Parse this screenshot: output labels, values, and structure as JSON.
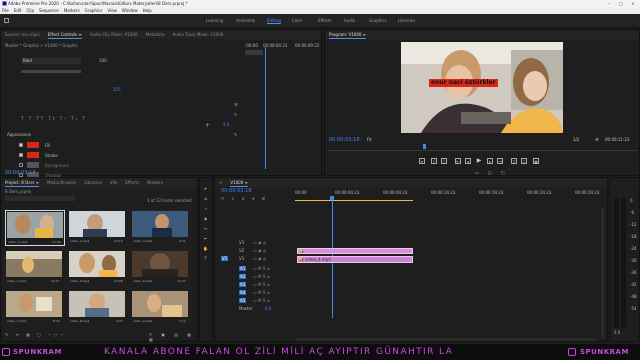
{
  "window": {
    "title": "Adobe Premiere Pro 2020 - C:\\Kullanıcılar\\Spoc\\Masaüstü\\Kurs Materyalleri\\8 Ders.prproj *",
    "controls": [
      "–",
      "□",
      "×"
    ]
  },
  "menu": [
    "File",
    "Edit",
    "Clip",
    "Sequence",
    "Markers",
    "Graphics",
    "View",
    "Window",
    "Help"
  ],
  "workspaces": {
    "items": [
      "Learning",
      "Assembly",
      "Editing",
      "Color",
      "Effects",
      "Audio",
      "Graphics",
      "Libraries"
    ],
    "active_index": 2
  },
  "source_panel": {
    "tabs": [
      "Source: (no clips)",
      "Effect Controls ≡",
      "Audio Clip Mixer: V1000",
      "Metadata",
      "Audio Track Mixer: V1000"
    ],
    "active_index": 1,
    "subheader": "Master * Graphic  >  V1000 * Graphic",
    "ruler_start": ":00:00",
    "ruler_mid": "00:00:04:23",
    "ruler_end": "00:00:09:22",
    "font_value": "Bold",
    "size_value": "100",
    "tracking_value": "125",
    "appearance_label": "Appearance",
    "fill_label": "Fill",
    "stroke_label": "Stroke",
    "stroke_value": "4.0",
    "background_label": "Background",
    "shadow_label": "Shadow",
    "mask_label": "Mask with Text",
    "transform_label": "Transform",
    "timecode": "00:00:03:18"
  },
  "program": {
    "tab": "Program: V1000 ≡",
    "overlay_text": "onur naci öztürkler",
    "timecode": "00:00:03:18",
    "fit": "Fit",
    "quality": "1/2",
    "duration": "00:00:11:23"
  },
  "project": {
    "tabs": [
      "Project: 8 Ders ≡",
      "Media Browser",
      "Libraries",
      "Info",
      "Effects",
      "Markers"
    ],
    "active_index": 0,
    "folder": "8 Ders.prproj",
    "item_count": "1 of 12 items selected",
    "clips": [
      {
        "name": "video_1.mp4",
        "dur": "12:00"
      },
      {
        "name": "video_2.mp4",
        "dur": "14:19"
      },
      {
        "name": "video_3.mp4",
        "dur": "9:21"
      },
      {
        "name": "video_4.mp4",
        "dur": "12:11"
      },
      {
        "name": "video_5.mp4",
        "dur": "23:08"
      },
      {
        "name": "video_6.mp4",
        "dur": "12:07"
      },
      {
        "name": "video_7.mp4",
        "dur": "8:22"
      },
      {
        "name": "video_8.mp4",
        "dur": "6:23"
      },
      {
        "name": "video_9.mp4",
        "dur": "7:12"
      }
    ]
  },
  "timeline": {
    "tab": "V1000 ≡",
    "timecode": "00:00:03:18",
    "ruler": [
      "00:00",
      "00:00:04:23",
      "00:00:09:23",
      "00:00:14:23",
      "00:00:19:23",
      "00:00:24:23",
      "00:00:29:23"
    ],
    "video_tracks": [
      "V3",
      "V2",
      "V1"
    ],
    "audio_tracks": [
      "A1",
      "A2",
      "A3",
      "A4",
      "A5"
    ],
    "master": "Master",
    "master_val": "0.0",
    "clip_graphic": "fx",
    "clip_video": "fx video_4.mp4",
    "meter_ticks": [
      "0",
      "-6",
      "-12",
      "-18",
      "-24",
      "-30",
      "-36",
      "-42",
      "-48",
      "-54"
    ],
    "meter_bottom": "S  S"
  },
  "banner": {
    "left_brand": "SPUNKRAM",
    "text": "KANALA ABONE FALAN OL ZİLİ MİLİ AÇ AYIPTIR GÜNAHTIR LA",
    "right_brand": "SPUNKRAM"
  },
  "colors": {
    "accent": "#3d8bf0",
    "fill_red": "#d8261b",
    "clip_pink": "#d98fd6",
    "banner_purple": "#c44bd9"
  }
}
